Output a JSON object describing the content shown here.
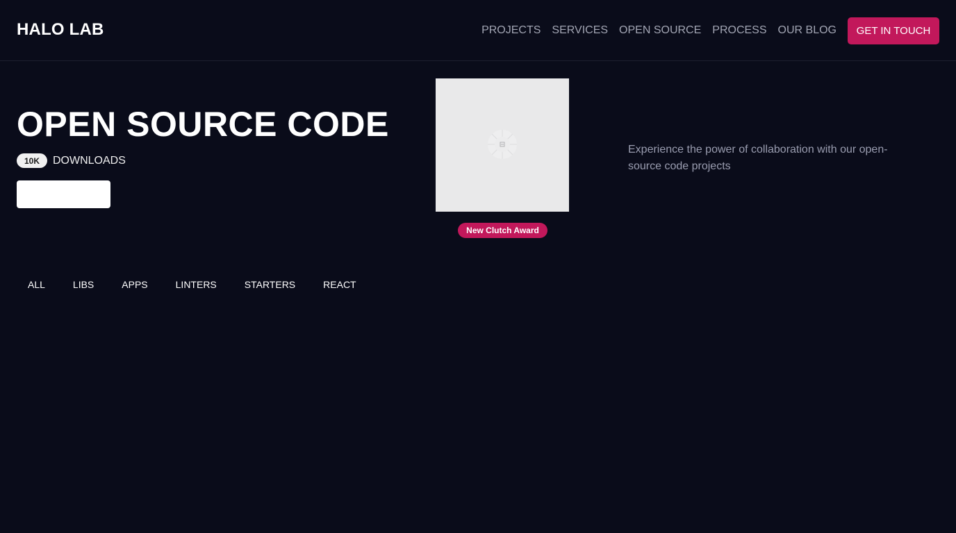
{
  "header": {
    "logo": "HALO LAB",
    "nav": [
      "PROJECTS",
      "SERVICES",
      "OPEN SOURCE",
      "PROCESS",
      "OUR BLOG"
    ],
    "cta": "GET IN TOUCH"
  },
  "hero": {
    "title": "OPEN SOURCE CODE",
    "downloads_badge": "10K",
    "downloads_label": "DOWNLOADS",
    "award_badge": "New Clutch Award",
    "description": "Experience the power of collaboration with our open-source code projects"
  },
  "filters": [
    "ALL",
    "LIBS",
    "APPS",
    "LINTERS",
    "STARTERS",
    "REACT"
  ],
  "colors": {
    "background": "#0a0c1a",
    "accent": "#c2185b",
    "nav_text": "#a3a6b4",
    "muted_text": "#9a9db0"
  },
  "icons": {
    "award_placeholder": "loading-spinner-icon"
  }
}
